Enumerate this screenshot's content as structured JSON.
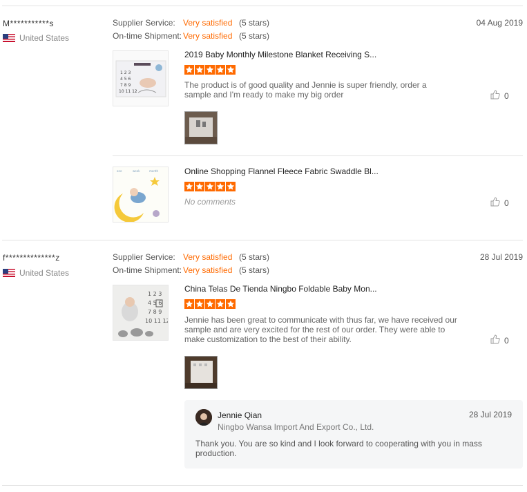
{
  "reviews": [
    {
      "username": "M***********s",
      "country": "United States",
      "date": "04 Aug 2019",
      "supplier_service_label": "Supplier Service:",
      "supplier_service_value": "Very satisfied",
      "supplier_service_stars": "(5 stars)",
      "shipment_label": "On-time Shipment:",
      "shipment_value": "Very satisfied",
      "shipment_stars": "(5 stars)",
      "products": [
        {
          "title": "2019 Baby Monthly Milestone Blanket Receiving S...",
          "rating": 5,
          "comment": "The product is of good quality and Jennie is super friendly, order a sample and I'm ready to make my big order",
          "likes": "0"
        },
        {
          "title": "Online Shopping Flannel Fleece Fabric Swaddle Bl...",
          "rating": 5,
          "comment": "No comments",
          "likes": "0"
        }
      ]
    },
    {
      "username": "f**************z",
      "country": "United States",
      "date": "28 Jul 2019",
      "supplier_service_label": "Supplier Service:",
      "supplier_service_value": "Very satisfied",
      "supplier_service_stars": "(5 stars)",
      "shipment_label": "On-time Shipment:",
      "shipment_value": "Very satisfied",
      "shipment_stars": "(5 stars)",
      "products": [
        {
          "title": "China Telas De Tienda Ningbo Foldable Baby Mon...",
          "rating": 5,
          "comment": "Jennie has been great to communicate with thus far, we have received our sample and are very excited for the rest of our order. They were able to make customization to the best of their ability.",
          "likes": "0"
        }
      ],
      "reply": {
        "name": "Jennie Qian",
        "company": "Ningbo Wansa Import And Export Co., Ltd.",
        "date": "28 Jul 2019",
        "text": "Thank you. You are so kind and I look forward to cooperating with you in mass production."
      }
    }
  ],
  "colors": {
    "accent": "#ff6a00",
    "divider": "#e3e3e3",
    "reply_bg": "#f5f6f7"
  },
  "icons": {
    "flag": "us-flag-icon",
    "star": "star-icon",
    "like": "thumbs-up-icon",
    "avatar": "avatar"
  }
}
